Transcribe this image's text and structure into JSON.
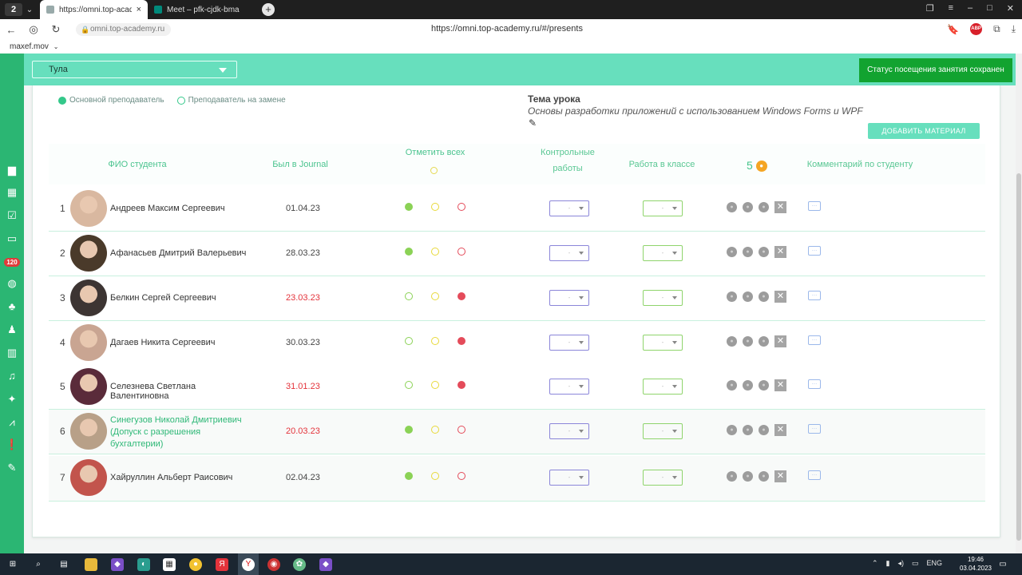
{
  "browser": {
    "profile_number": "2",
    "tabs": [
      {
        "title": "https://omni.top-acade",
        "active": true
      },
      {
        "title": "Meet – pfk-cjdk-bma",
        "active": false
      }
    ],
    "new_tab": "+",
    "address_domain": "omni.top-academy.ru",
    "address_url": "https://omni.top-academy.ru/#/presents",
    "adblock_label": "ABP",
    "bookmark_label": "maxef.mov"
  },
  "header": {
    "city": "Тула",
    "toast": "Статус посещения занятия сохранен"
  },
  "legend": {
    "main_teacher": "Основной преподаватель",
    "substitute_teacher": "Преподаватель на замене"
  },
  "topic": {
    "label": "Тема урока",
    "text": "Основы разработки приложений с использованием Windows Forms и WPF"
  },
  "add_material_label": "ДОБАВИТЬ МАТЕРИАЛ",
  "table": {
    "headers": {
      "student": "ФИО студента",
      "journal": "Был в Journal",
      "mark_all": "Отметить всех",
      "control_line1": "Контрольные",
      "control_line2": "работы",
      "classwork": "Работа в классе",
      "coins": "5",
      "comment": "Комментарий по студенту"
    },
    "select_placeholder": "-",
    "rows": [
      {
        "num": "1",
        "name": "Андреев Максим Сергеевич",
        "date": "01.04.23",
        "date_red": false,
        "att": [
          "g-fill",
          "y-ring",
          "r-ring"
        ],
        "avatar": "#d9b8a0",
        "green": false
      },
      {
        "num": "2",
        "name": "Афанасьев Дмитрий Валерьевич",
        "date": "28.03.23",
        "date_red": false,
        "att": [
          "g-fill",
          "y-ring",
          "r-ring"
        ],
        "avatar": "#4a3a2a",
        "green": false
      },
      {
        "num": "3",
        "name": "Белкин Сергей Сергеевич",
        "date": "23.03.23",
        "date_red": true,
        "att": [
          "g-ring",
          "y-ring",
          "r-fill"
        ],
        "avatar": "#3d3533",
        "green": false
      },
      {
        "num": "4",
        "name": "Дагаев Никита Сергеевич",
        "date": "30.03.23",
        "date_red": false,
        "att": [
          "g-ring",
          "y-ring",
          "r-fill"
        ],
        "avatar": "#c9a592",
        "green": false
      },
      {
        "num": "5",
        "name": "Селезнева Светлана Валентиновна",
        "date": "31.01.23",
        "date_red": true,
        "att": [
          "g-ring",
          "y-ring",
          "r-fill"
        ],
        "avatar": "#5a2b3a",
        "green": false
      },
      {
        "num": "6",
        "name": "Синегузов Николай Дмитриевич (Допуск с разрешения бухгалтерии)",
        "date": "20.03.23",
        "date_red": true,
        "att": [
          "g-fill",
          "y-ring",
          "r-ring"
        ],
        "avatar": "#b8a088",
        "green": true
      },
      {
        "num": "7",
        "name": "Хайруллин Альберт Раисович",
        "date": "02.04.23",
        "date_red": false,
        "att": [
          "g-fill",
          "y-ring",
          "r-ring"
        ],
        "avatar": "#c2544c",
        "green": false
      }
    ]
  },
  "taskbar": {
    "lang": "ENG",
    "time": "19:46",
    "date": "03.04.2023"
  },
  "colors": {
    "accent": "#67dfbd",
    "sidebar": "#2bb673",
    "toast": "#12a330"
  }
}
